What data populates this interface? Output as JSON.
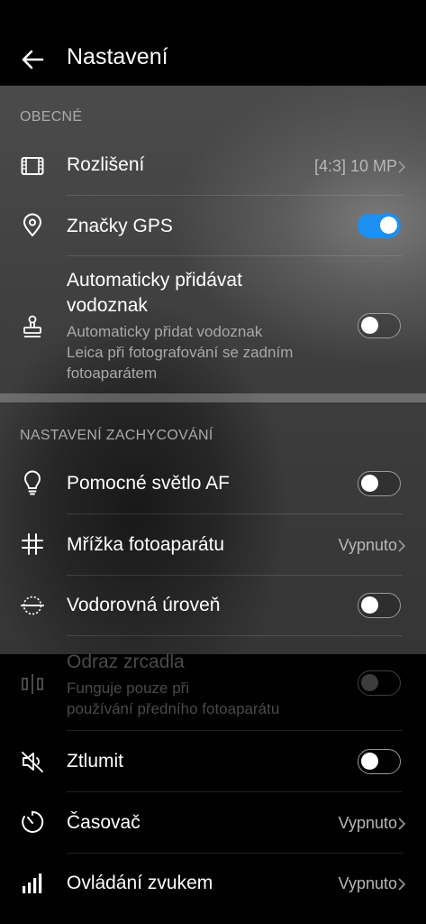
{
  "header": {
    "title": "Nastavení"
  },
  "sections": {
    "general": "OBECNÉ",
    "capture": "NASTAVENÍ ZACHYCOVÁNÍ"
  },
  "items": {
    "resolution": {
      "label": "Rozlišení",
      "value": "[4:3] 10 MP",
      "icon": "resolution-icon"
    },
    "gps": {
      "label": "Značky GPS",
      "toggle": true,
      "icon": "location-pin-icon"
    },
    "watermark": {
      "label_line1": "Automaticky přidávat",
      "label_line2": "vodoznak",
      "sub_line1": "Automaticky přidat vodoznak",
      "sub_line2": "Leica při fotografování se zadním",
      "sub_line3": "fotoaparátem",
      "toggle": false,
      "icon": "stamp-icon"
    },
    "af_light": {
      "label": "Pomocné světlo AF",
      "toggle": false,
      "icon": "lightbulb-icon"
    },
    "grid": {
      "label": "Mřížka fotoaparátu",
      "value": "Vypnuto",
      "icon": "grid-icon"
    },
    "level": {
      "label": "Vodorovná úroveň",
      "toggle": false,
      "icon": "level-icon"
    },
    "mirror": {
      "label": "Odraz zrcadla",
      "sub_line1": "Funguje pouze při",
      "sub_line2": "používání předního fotoaparátu",
      "toggle": false,
      "disabled": true,
      "icon": "mirror-icon"
    },
    "mute": {
      "label": "Ztlumit",
      "toggle": false,
      "icon": "speaker-muted-icon"
    },
    "timer": {
      "label": "Časovač",
      "value": "Vypnuto",
      "icon": "timer-icon"
    },
    "voice": {
      "label": "Ovládání zvukem",
      "value": "Vypnuto",
      "icon": "signal-bars-icon"
    }
  },
  "colors": {
    "accent": "#1d8ff0",
    "background": "#000000",
    "secondary_text": "#a9a9a9"
  }
}
